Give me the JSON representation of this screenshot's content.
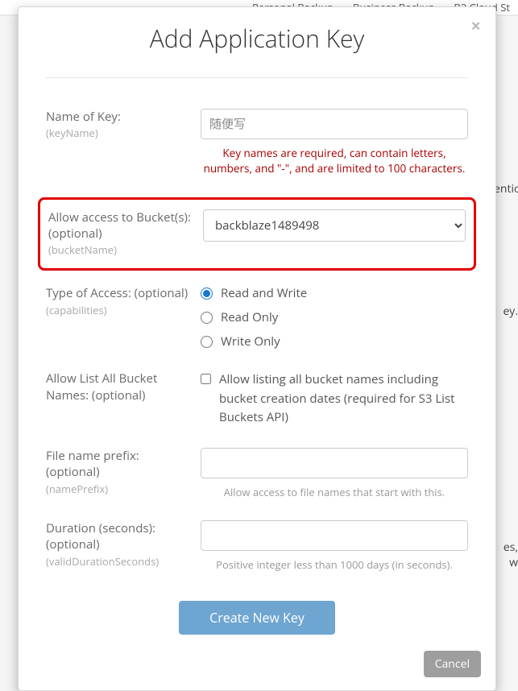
{
  "backdrop": {
    "nav": [
      "Personal Backup",
      "Business Backup",
      "B2 Cloud St"
    ],
    "lines": [
      "ention",
      "ey.",
      "es, w"
    ]
  },
  "modal": {
    "title": "Add Application Key",
    "close": "×",
    "fields": {
      "name": {
        "label": "Name of Key:",
        "api": "(keyName)",
        "placeholder": "随便写",
        "error": "Key names are required, can contain letters, numbers, and \"-\", and are limited to 100 characters."
      },
      "bucket": {
        "label": "Allow access to Bucket(s): (optional)",
        "api": "(bucketName)",
        "selected": "backblaze1489498"
      },
      "access": {
        "label": "Type of Access: (optional)",
        "api": "(capabilities)",
        "options": {
          "rw": "Read and Write",
          "ro": "Read Only",
          "wo": "Write Only"
        }
      },
      "listAll": {
        "label": "Allow List All Bucket Names: (optional)",
        "checkbox": "Allow listing all bucket names including bucket creation dates (required for S3 List Buckets API)"
      },
      "prefix": {
        "label": "File name prefix: (optional)",
        "api": "(namePrefix)",
        "helper": "Allow access to file names that start with this."
      },
      "duration": {
        "label": "Duration (seconds): (optional)",
        "api": "(validDurationSeconds)",
        "helper": "Positive integer less than 1000 days (in seconds)."
      }
    },
    "buttons": {
      "create": "Create New Key",
      "cancel": "Cancel"
    }
  }
}
